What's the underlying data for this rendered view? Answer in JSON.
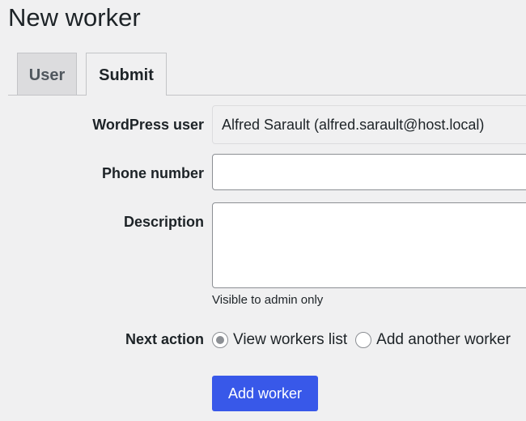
{
  "page": {
    "title": "New worker"
  },
  "tabs": [
    {
      "label": "User",
      "active": false
    },
    {
      "label": "Submit",
      "active": true
    }
  ],
  "form": {
    "wordpress_user": {
      "label": "WordPress user",
      "value": "Alfred Sarault (alfred.sarault@host.local)"
    },
    "phone": {
      "label": "Phone number",
      "value": ""
    },
    "description": {
      "label": "Description",
      "value": "",
      "hint": "Visible to admin only"
    },
    "next_action": {
      "label": "Next action",
      "options": [
        {
          "label": "View workers list",
          "checked": true
        },
        {
          "label": "Add another worker",
          "checked": false
        }
      ]
    },
    "submit_label": "Add worker"
  },
  "colors": {
    "accent": "#3858e9",
    "background": "#f0f0f1"
  }
}
